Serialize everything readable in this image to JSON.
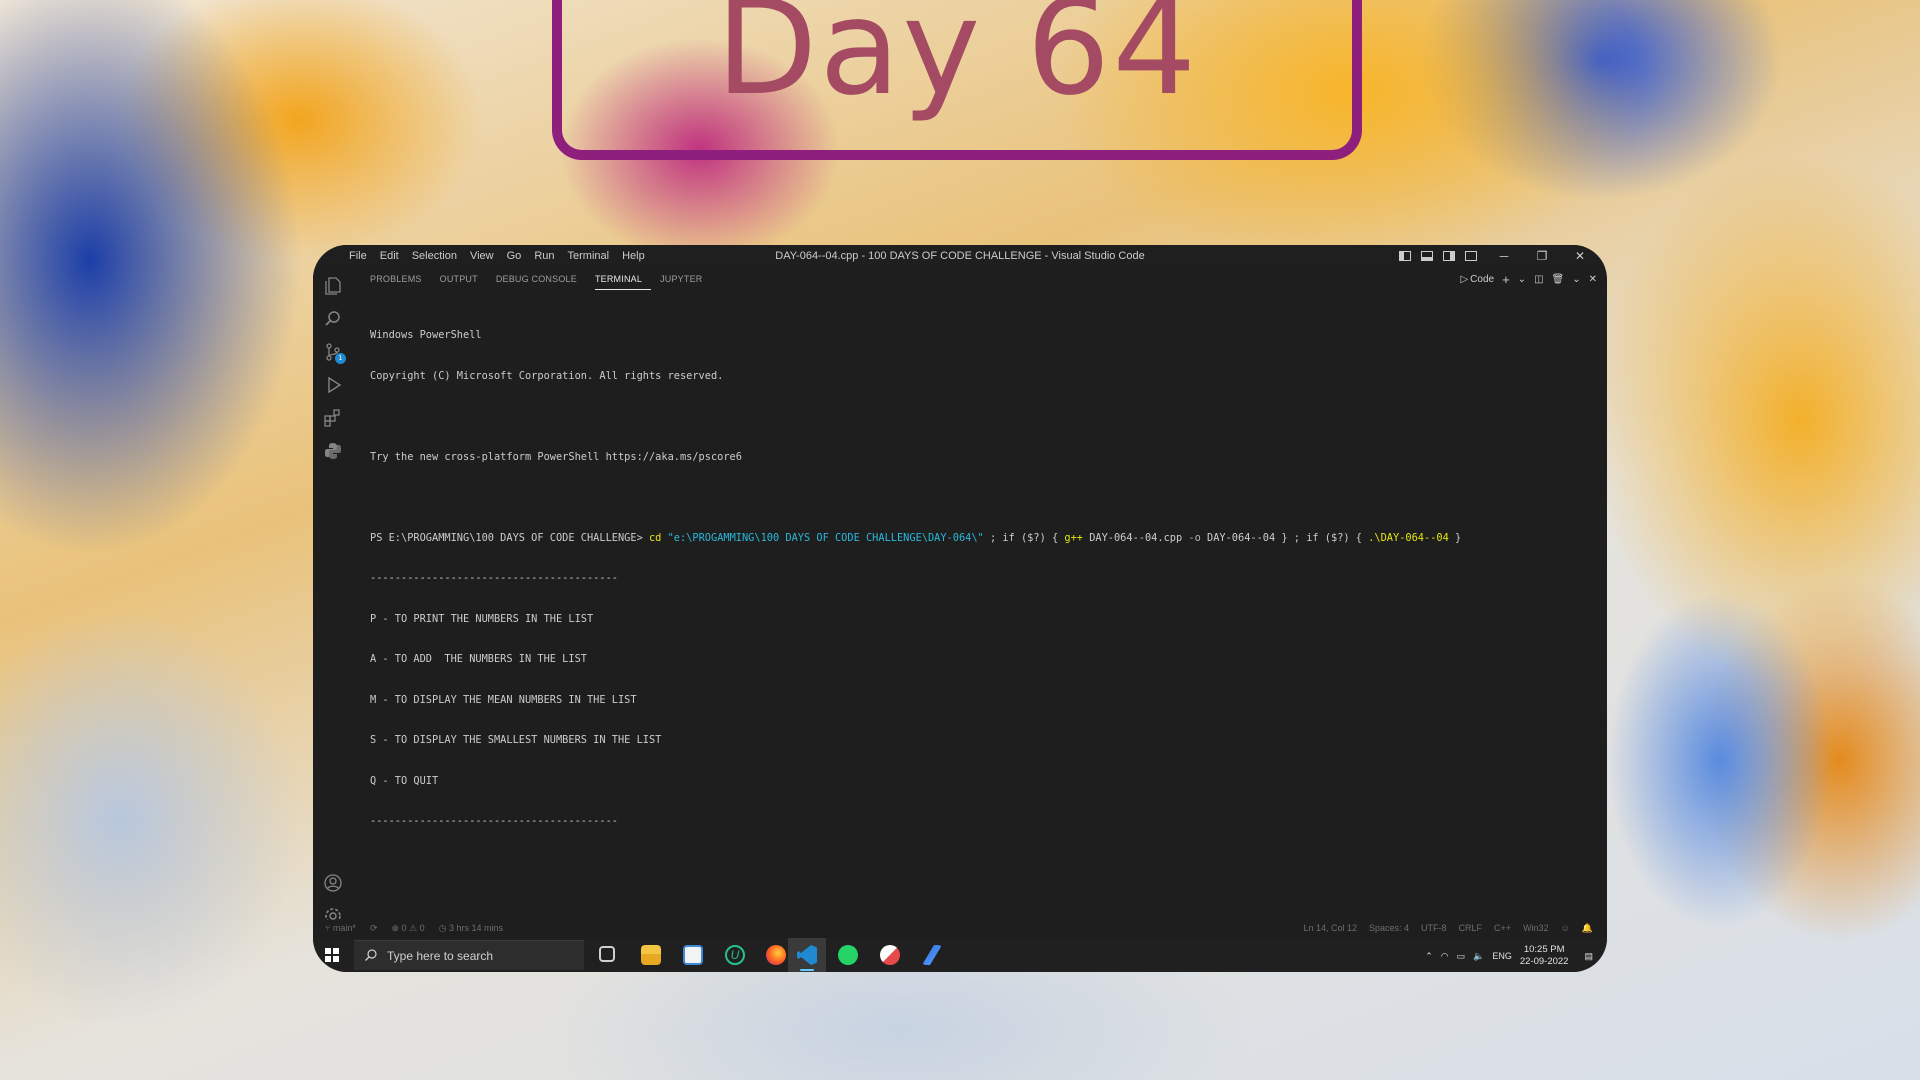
{
  "banner": {
    "title": "Day 64"
  },
  "window": {
    "title": "DAY-064--04.cpp - 100 DAYS OF CODE CHALLENGE - Visual Studio Code",
    "menu": [
      "File",
      "Edit",
      "Selection",
      "View",
      "Go",
      "Run",
      "Terminal",
      "Help"
    ],
    "controls": {
      "minimize": "─",
      "restore": "❐",
      "close": "✕"
    }
  },
  "activity_bar": {
    "icons": [
      "explorer-icon",
      "search-icon",
      "source-control-icon",
      "run-debug-icon",
      "extensions-icon",
      "python-icon",
      "account-icon",
      "settings-icon"
    ],
    "source_control_badge": "1"
  },
  "panel": {
    "tabs": [
      "PROBLEMS",
      "OUTPUT",
      "DEBUG CONSOLE",
      "TERMINAL",
      "JUPYTER"
    ],
    "active_tab": "TERMINAL",
    "shell_label": "Code"
  },
  "terminal": {
    "line1": "Windows PowerShell",
    "line2": "Copyright (C) Microsoft Corporation. All rights reserved.",
    "line3": "Try the new cross-platform PowerShell https://aka.ms/pscore6",
    "prompt": "PS E:\\PROGAMMING\\100 DAYS OF CODE CHALLENGE>",
    "cmd_cd": "cd",
    "cmd_path": "\"e:\\PROGAMMING\\100 DAYS OF CODE CHALLENGE\\DAY-064\\\"",
    "cmd_sep1": "; if ($?) {",
    "cmd_gpp": "g++",
    "cmd_file": "DAY-064--04.cpp",
    "cmd_flag": "-o",
    "cmd_out": "DAY-064--04",
    "cmd_sep2": "} ; if ($?) {",
    "cmd_run": ".\\DAY-064--04",
    "cmd_end": "}",
    "divider": "----------------------------------------",
    "menu_lines": [
      "P - TO PRINT THE NUMBERS IN THE LIST",
      "A - TO ADD  THE NUMBERS IN THE LIST",
      "M - TO DISPLAY THE MEAN NUMBERS IN THE LIST",
      "S - TO DISPLAY THE SMALLEST NUMBERS IN THE LIST",
      "Q - TO QUIT"
    ]
  },
  "status_bar": {
    "branch": "main*",
    "errors": "0",
    "warnings": "0",
    "time_spent": "3 hrs 14 mins",
    "position": "Ln 14, Col 12",
    "spaces": "Spaces: 4",
    "encoding": "UTF-8",
    "eol": "CRLF",
    "language": "C++",
    "platform": "Win32"
  },
  "taskbar": {
    "search_placeholder": "Type here to search",
    "language": "ENG",
    "time": "10:25 PM",
    "date": "22-09-2022"
  },
  "colors": {
    "accent_purple": "#8e1f7d",
    "title_text": "#a44a63",
    "editor_bg": "#1e1e1e"
  }
}
